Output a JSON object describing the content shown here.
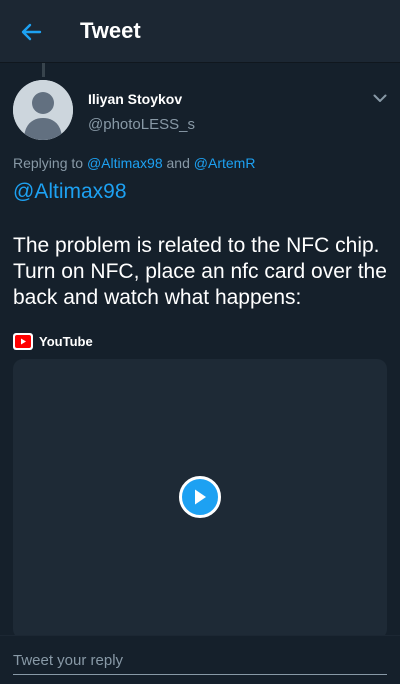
{
  "header": {
    "title": "Tweet",
    "back_icon": "arrow-left-icon"
  },
  "tweet": {
    "author": {
      "name": "Iliyan Stoykov",
      "handle": "@photoLESS_s",
      "avatar_icon": "default-avatar-icon"
    },
    "menu_icon": "chevron-down-icon",
    "replying_prefix": "Replying to",
    "replying_user_1": "@Altimax98",
    "replying_and": "and",
    "replying_user_2": "@ArtemR",
    "mention": "@Altimax98",
    "text": "The problem is related to the NFC chip. Turn on NFC, place an nfc card over the back and watch what happens:",
    "media": {
      "source_label": "YouTube",
      "source_icon": "youtube-icon",
      "play_icon": "play-icon"
    }
  },
  "reply": {
    "placeholder": "Tweet your reply"
  },
  "colors": {
    "background": "#15202b",
    "header_bg": "#1c2733",
    "accent": "#1da1f2",
    "secondary_text": "#8899a6",
    "youtube_red": "#ff0000"
  }
}
